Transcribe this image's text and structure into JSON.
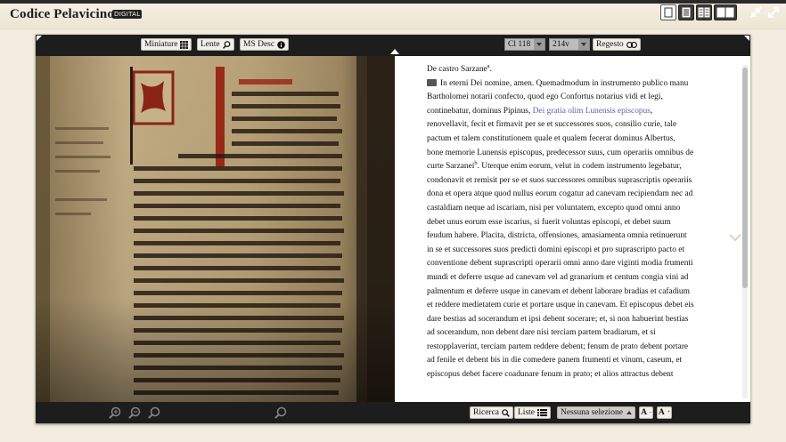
{
  "header": {
    "title": "Codice Pelavicino",
    "badge": "DIGITAL"
  },
  "image_toolbar": {
    "thumbnails_label": "Miniature",
    "magnifier_label": "Lente",
    "ms_desc_label": "MS Desc"
  },
  "text_toolbar": {
    "witness_value": "Cl 118",
    "page_value": "214v",
    "regesto_label": "Regesto"
  },
  "text": {
    "heading": "De castro Sarzane",
    "heading_note": "a",
    "note2": "b",
    "line1": "In eterni Dei nomine, amen. Quemadmodum in instrumento publico manu",
    "line2": "Bartholomei notarii confecto, quod ego Confortus notarius vidi et legi,",
    "line3_a": "continebatur, dominus Pipinus, ",
    "line3_b": "Dei gratia olim Lunensis episcopus",
    "line3_c": ",",
    "line4": "renovellavit, fecit et firmavit per se et successores suos, consilio curie, tale",
    "line5": "pactum et talem constitutionem quale et qualem fecerat dominus Albertus,",
    "line6": "bone memorie Lunensis episcopus, predecessor suus, cum operariis omnibus de",
    "line7_a": "curte Sarzanei",
    "line7_b": ". Uterque enim eorum, velut in codem instrumento legebatur,",
    "line8": "condonavit et remisit per se et suos successores omnibus suprascriptis operariis",
    "line9": "dona et opera atque quod nullus eorum cogatur ad canevam recipiendam nec ad",
    "line10": "castaldiam neque ad iscariam, nisi per voluntatem, excepto quod omni anno",
    "line11": "debet unus eorum esse iscarius, si fuerit voluntas episcopi, et debet suum",
    "line12": "feudum habere. Placita, districta, offensiones, amasiamenta omnia retinuerunt",
    "line13": "in se et successores suos predicti domini episcopi et pro suprascripto pacto et",
    "line14": "conventione debent suprascripti operarii omni anno dare viginti modia frumenti",
    "line15": "mundi et deferre usque ad canevam vel ad granarium et centum congia vini ad",
    "line16": "palmentum et deferre usque in canevam et debent laborare bradias et cafadium",
    "line17": "et reddere medietatem curie et portare usque in canevam. Et episcopus debet eis",
    "line18": "dare bestias ad socerandum et ipsi debent socerare; et, si non habuerint bestias",
    "line19": "ad socerandum, non debent dare nisi terciam partem bradiarum, et si",
    "line20": "restopplaverint, terciam partem reddere debent; fenum de prato debent portare",
    "line21": "ad fenile et debent bis in die comedere panem frumenti et vinum, caseum, et",
    "line22": "episcopus debet facere coadunare fenum in prato; et alios attractus debent"
  },
  "bottom_toolbar": {
    "search_label": "Ricerca",
    "lists_label": "Liste",
    "selection_value": "Nessuna selezione",
    "font_down": "A",
    "font_up": "A"
  },
  "icons": {
    "view_single": "single-page-icon",
    "view_text": "text-only-icon",
    "view_parallel": "parallel-text-icon",
    "view_book": "book-icon",
    "fullscreen": "fullscreen-icon",
    "expand": "expand-icon"
  },
  "colors": {
    "accent": "#5b5fb0",
    "frame": "#1d1d1d",
    "background": "#f3ede0"
  }
}
